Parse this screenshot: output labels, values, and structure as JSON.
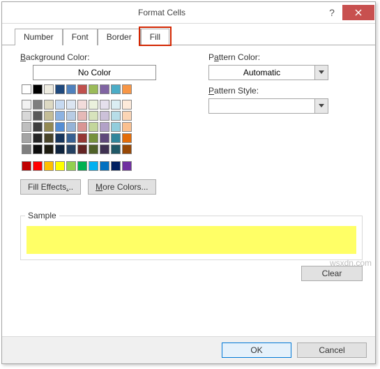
{
  "titlebar": {
    "title": "Format Cells"
  },
  "tabs": {
    "number": "Number",
    "font": "Font",
    "border": "Border",
    "fill": "Fill",
    "active": "fill"
  },
  "bg": {
    "label": "Background Color:",
    "no_color": "No Color",
    "fill_effects": "Fill Effects...",
    "more_colors": "More Colors..."
  },
  "pattern": {
    "color_label": "Pattern Color:",
    "color_value": "Automatic",
    "style_label": "Pattern Style:",
    "style_value": ""
  },
  "sample": {
    "label": "Sample",
    "color": "#ffff66"
  },
  "buttons": {
    "clear": "Clear",
    "ok": "OK",
    "cancel": "Cancel"
  },
  "watermark": "wsxdn.com",
  "palette": {
    "row1": [
      "#ffffff",
      "#000000",
      "#eeece1",
      "#1f497d",
      "#4f81bd",
      "#c0504d",
      "#9bbb59",
      "#8064a2",
      "#4bacc6",
      "#f79646"
    ],
    "theme": [
      [
        "#f2f2f2",
        "#7f7f7f",
        "#ddd9c3",
        "#c6d9f0",
        "#dbe5f1",
        "#f2dcdb",
        "#ebf1dd",
        "#e5e0ec",
        "#dbeef3",
        "#fdeada"
      ],
      [
        "#d8d8d8",
        "#595959",
        "#c4bd97",
        "#8db3e2",
        "#b8cce4",
        "#e5b9b7",
        "#d7e3bc",
        "#ccc1d9",
        "#b7dde8",
        "#fbd5b5"
      ],
      [
        "#bfbfbf",
        "#3f3f3f",
        "#938953",
        "#548dd4",
        "#95b3d7",
        "#d99694",
        "#c3d69b",
        "#b2a2c7",
        "#92cddc",
        "#fac08f"
      ],
      [
        "#a5a5a5",
        "#262626",
        "#494429",
        "#17365d",
        "#366092",
        "#953734",
        "#76923c",
        "#5f497a",
        "#31859b",
        "#e36c09"
      ],
      [
        "#7f7f7f",
        "#0c0c0c",
        "#1d1b10",
        "#0f243e",
        "#244061",
        "#632423",
        "#4f6128",
        "#3f3151",
        "#205867",
        "#974806"
      ]
    ],
    "standard": [
      "#c00000",
      "#ff0000",
      "#ffc000",
      "#ffff00",
      "#92d050",
      "#00b050",
      "#00b0f0",
      "#0070c0",
      "#002060",
      "#7030a0"
    ]
  }
}
